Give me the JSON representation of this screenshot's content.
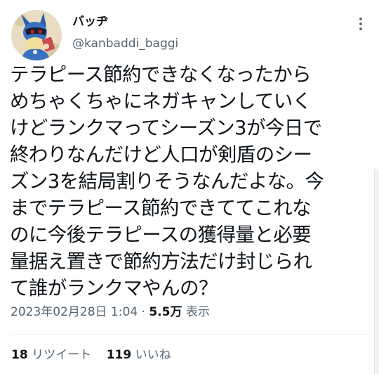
{
  "tweet": {
    "author": {
      "display_name": "バッヂ",
      "handle": "@kanbaddi_baggi",
      "avatar_icon": "lucario-avatar-icon"
    },
    "more_icon": "more-dots-icon",
    "text_lines": [
      "テラピース節約できなくなったから",
      "めちゃくちゃにネガキャンしていく",
      "けどランクマってシーズン3が今日で",
      "終わりなんだけど人口が剣盾のシー",
      "ズン3を結局割りそうなんだよな。今",
      "までテラピース節約できててこれな",
      "のに今後テラピースの獲得量と必要",
      "量据え置きで節約方法だけ封じられ",
      "て誰がランクマやんの？"
    ],
    "timestamp": "2023年02月28日 1:04",
    "separator": "·",
    "views_count": "5.5万",
    "views_label": "表示",
    "retweets_count": "18",
    "retweets_label": "リツイート",
    "likes_count": "119",
    "likes_label": "いいね"
  },
  "colors": {
    "text_primary": "#0f1419",
    "text_secondary": "#536471",
    "divider": "#eff3f4",
    "background": "#ffffff"
  }
}
